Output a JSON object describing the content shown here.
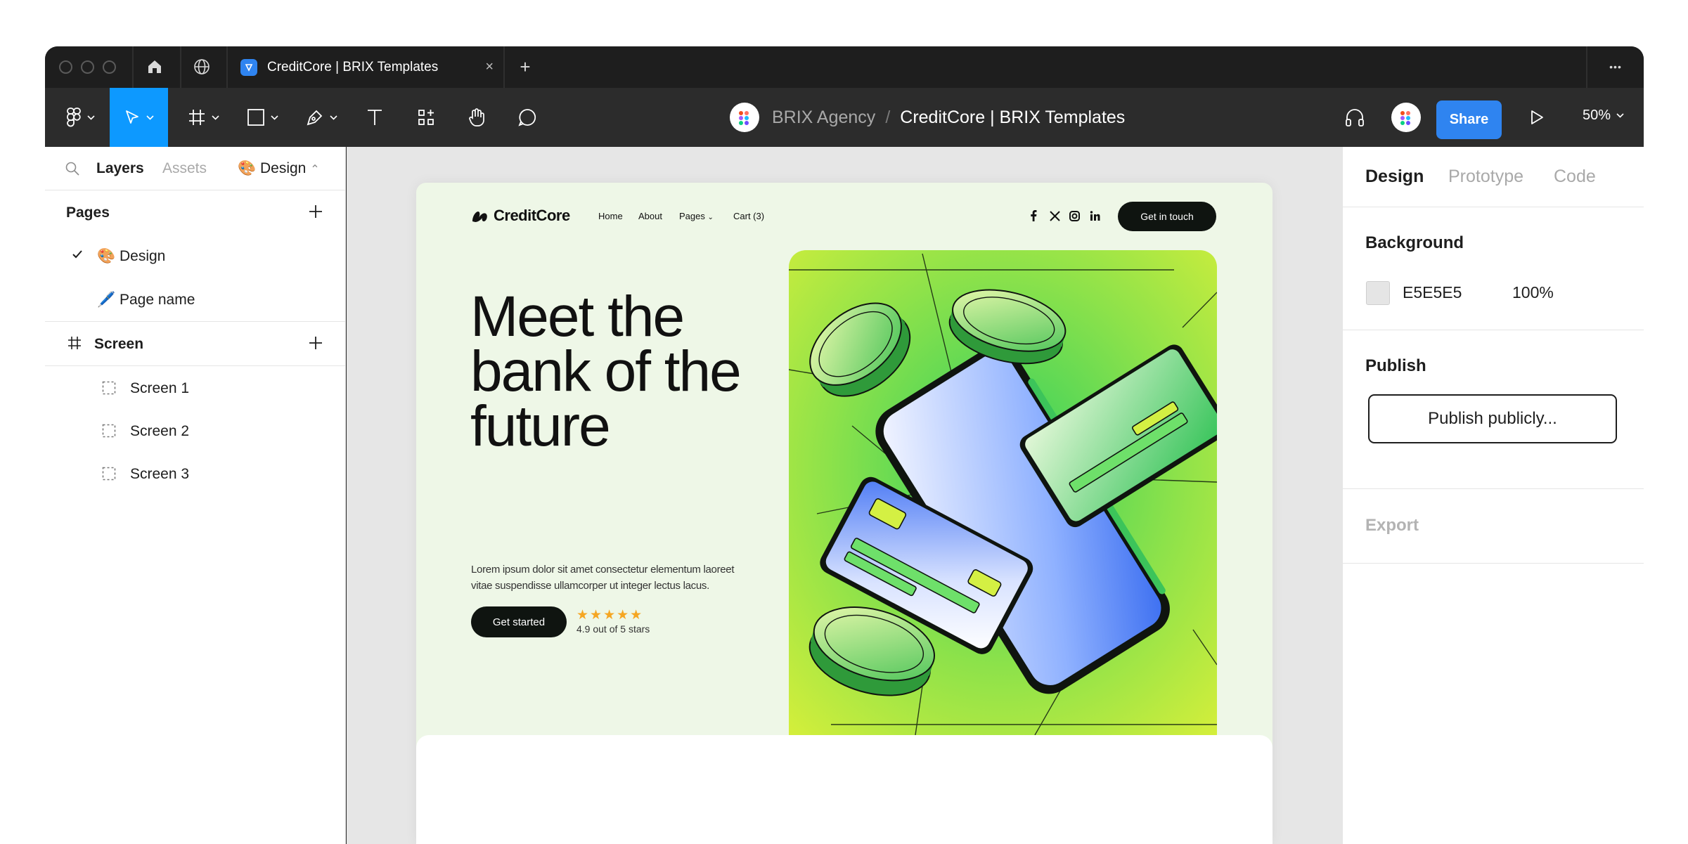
{
  "tabbar": {
    "tab_title": "CreditCore | BRIX Templates",
    "close_glyph": "×",
    "new_tab_glyph": "+",
    "more_glyph": "•••"
  },
  "toolbar": {
    "breadcrumb": {
      "team": "BRIX Agency",
      "separator": "/",
      "file": "CreditCore | BRIX Templates"
    },
    "share_label": "Share",
    "zoom_label": "50%",
    "accent_color": "#0d99ff"
  },
  "left_panel": {
    "tabs": {
      "layers": "Layers",
      "assets": "Assets",
      "page_selector": "🎨 Design"
    },
    "pages_title": "Pages",
    "pages": [
      {
        "label": "🎨 Design",
        "selected": true
      },
      {
        "label": "🖊️ Page name",
        "selected": false
      }
    ],
    "screen_section": "Screen",
    "layers": [
      "Screen 1",
      "Screen 2",
      "Screen 3"
    ]
  },
  "site": {
    "logo": "CreditCore",
    "nav": [
      "Home",
      "About",
      "Pages",
      "Cart (3)"
    ],
    "nav_cta": "Get in touch",
    "hero_title": "Meet the bank of the future",
    "hero_description": "Lorem ipsum dolor sit amet consectetur elementum laoreet vitae suspendisse ullamcorper ut integer lectus lacus.",
    "primary_cta": "Get started",
    "stars": "★★★★★",
    "rating_text": "4.9 out of 5 stars",
    "frame_background": "#eef7e7"
  },
  "right_panel": {
    "tabs": [
      "Design",
      "Prototype",
      "Code"
    ],
    "background_title": "Background",
    "background_hex": "E5E5E5",
    "background_opacity": "100%",
    "publish_title": "Publish",
    "publish_button": "Publish publicly...",
    "export_title": "Export"
  }
}
